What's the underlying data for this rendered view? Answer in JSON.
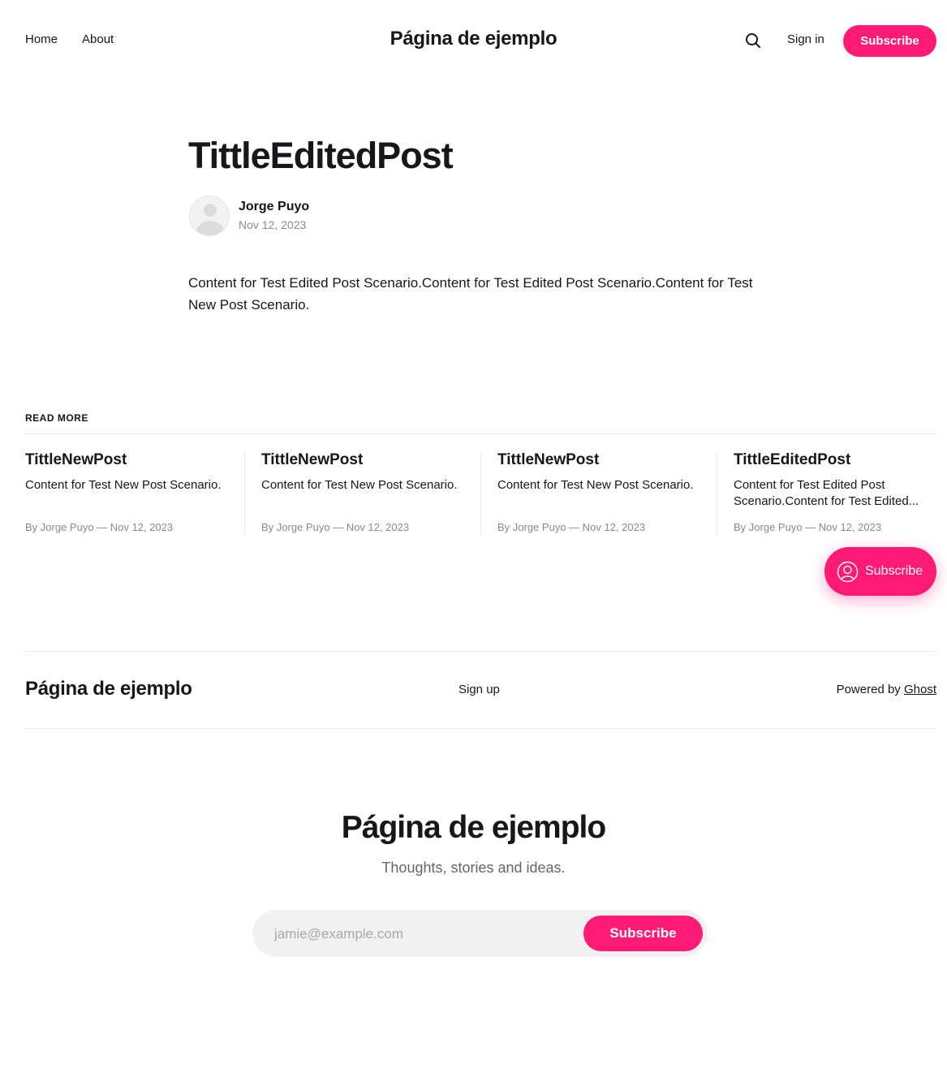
{
  "header": {
    "nav": [
      {
        "label": "Home"
      },
      {
        "label": "About"
      }
    ],
    "site_title": "Página de ejemplo",
    "search_icon": "search-icon",
    "sign_in": "Sign in",
    "subscribe": "Subscribe"
  },
  "article": {
    "title": "TittleEditedPost",
    "author": "Jorge Puyo",
    "date": "Nov 12, 2023",
    "content": "Content for Test Edited Post Scenario.Content for Test Edited Post Scenario.Content for Test New Post Scenario."
  },
  "read_more": {
    "heading": "READ MORE",
    "cards": [
      {
        "title": "TittleNewPost",
        "excerpt": "Content for Test New Post Scenario.",
        "meta": "By Jorge Puyo — Nov 12, 2023"
      },
      {
        "title": "TittleNewPost",
        "excerpt": "Content for Test New Post Scenario.",
        "meta": "By Jorge Puyo — Nov 12, 2023"
      },
      {
        "title": "TittleNewPost",
        "excerpt": "Content for Test New Post Scenario.",
        "meta": "By Jorge Puyo — Nov 12, 2023"
      },
      {
        "title": "TittleEditedPost",
        "excerpt": "Content for Test Edited Post Scenario.Content for Test Edited...",
        "meta": "By Jorge Puyo — Nov 12, 2023"
      }
    ]
  },
  "floating_subscribe": {
    "label": "Subscribe",
    "icon": "user-circle-icon"
  },
  "footer": {
    "site_title": "Página de ejemplo",
    "signup": "Sign up",
    "powered_prefix": "Powered by",
    "powered_link": "Ghost"
  },
  "cta": {
    "title": "Página de ejemplo",
    "subtitle": "Thoughts, stories and ideas.",
    "email_placeholder": "jamie@example.com",
    "button": "Subscribe"
  },
  "colors": {
    "accent": "#ff1a75",
    "text": "#15171a",
    "muted": "#8a8a8a"
  }
}
